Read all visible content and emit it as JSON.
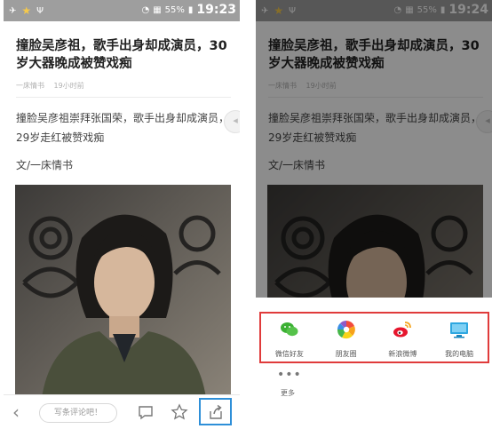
{
  "status_bar": {
    "battery": "55%",
    "left_screen_time": "19:23",
    "right_screen_time": "19:24"
  },
  "article": {
    "headline": "撞脸吴彦祖，歌手出身却成演员，30岁大器晚成被赞戏痴",
    "source": "一床情书",
    "time_ago": "19小时前",
    "summary": "撞脸吴彦祖崇拜张国荣，歌手出身却成演员，29岁走红被赞戏痴",
    "byline": "文/一床情书"
  },
  "bottom_bar": {
    "comment_placeholder": "写条评论吧！"
  },
  "share_sheet": {
    "targets": [
      {
        "label": "微信好友",
        "icon": "wechat-icon"
      },
      {
        "label": "朋友圈",
        "icon": "moments-icon"
      },
      {
        "label": "新浪微博",
        "icon": "weibo-icon"
      },
      {
        "label": "我的电脑",
        "icon": "computer-icon"
      }
    ],
    "more_label": "更多"
  },
  "colors": {
    "highlight_blue": "#2e8fd8",
    "highlight_red": "#e03b3b",
    "wechat_green": "#3cb034"
  }
}
